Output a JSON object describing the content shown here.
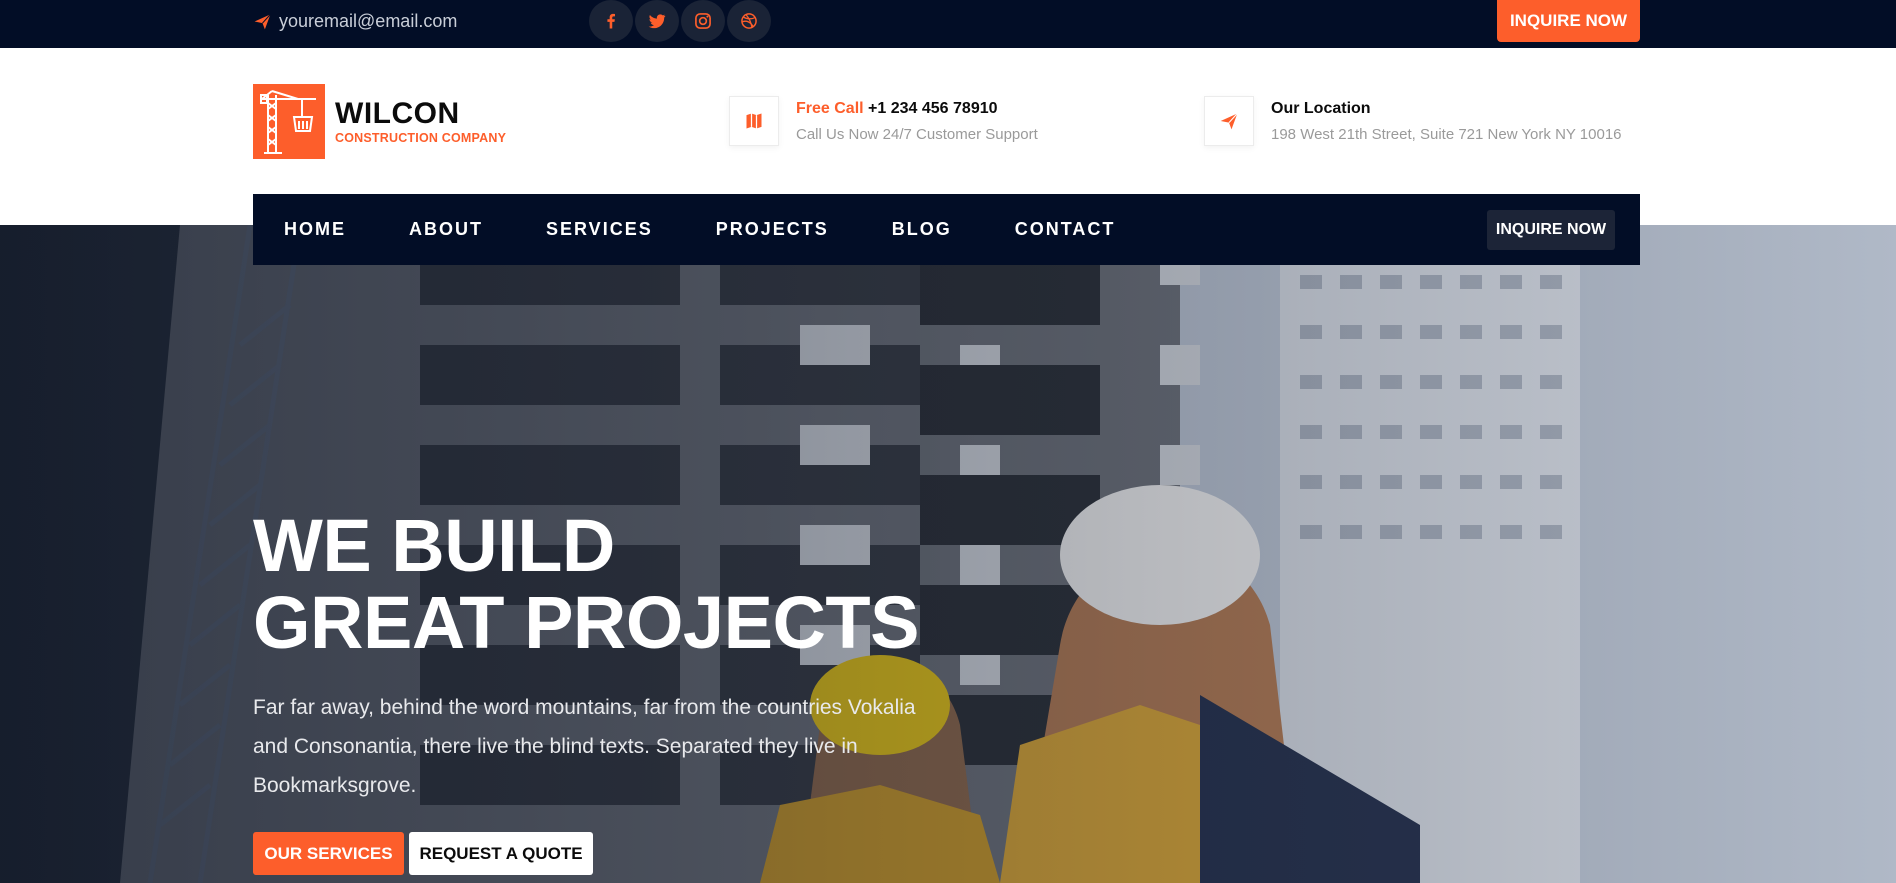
{
  "topbar": {
    "email": "youremail@email.com",
    "socials": [
      "facebook-icon",
      "twitter-icon",
      "instagram-icon",
      "dribbble-icon"
    ],
    "inquire_label": "INQUIRE NOW"
  },
  "brand": {
    "name": "WILCON",
    "tagline": "CONSTRUCTION COMPANY"
  },
  "contact": {
    "call_label": "Free Call",
    "phone": "+1 234 456 78910",
    "call_sub": "Call Us Now 24/7 Customer Support",
    "location_label": "Our Location",
    "address": "198 West 21th Street, Suite 721 New York NY 10016"
  },
  "nav": {
    "items": [
      "HOME",
      "ABOUT",
      "SERVICES",
      "PROJECTS",
      "BLOG",
      "CONTACT"
    ],
    "inquire_label": "INQUIRE NOW"
  },
  "hero": {
    "title_line1": "WE BUILD",
    "title_line2": "GREAT PROJECTS",
    "text": "Far far away, behind the word mountains, far from the countries Vokalia and Consonantia, there live the blind texts. Separated they live in Bookmarksgrove.",
    "primary_button": "OUR SERVICES",
    "secondary_button": "REQUEST A QUOTE"
  },
  "colors": {
    "accent": "#fd5e2b",
    "navy": "#020d26"
  }
}
